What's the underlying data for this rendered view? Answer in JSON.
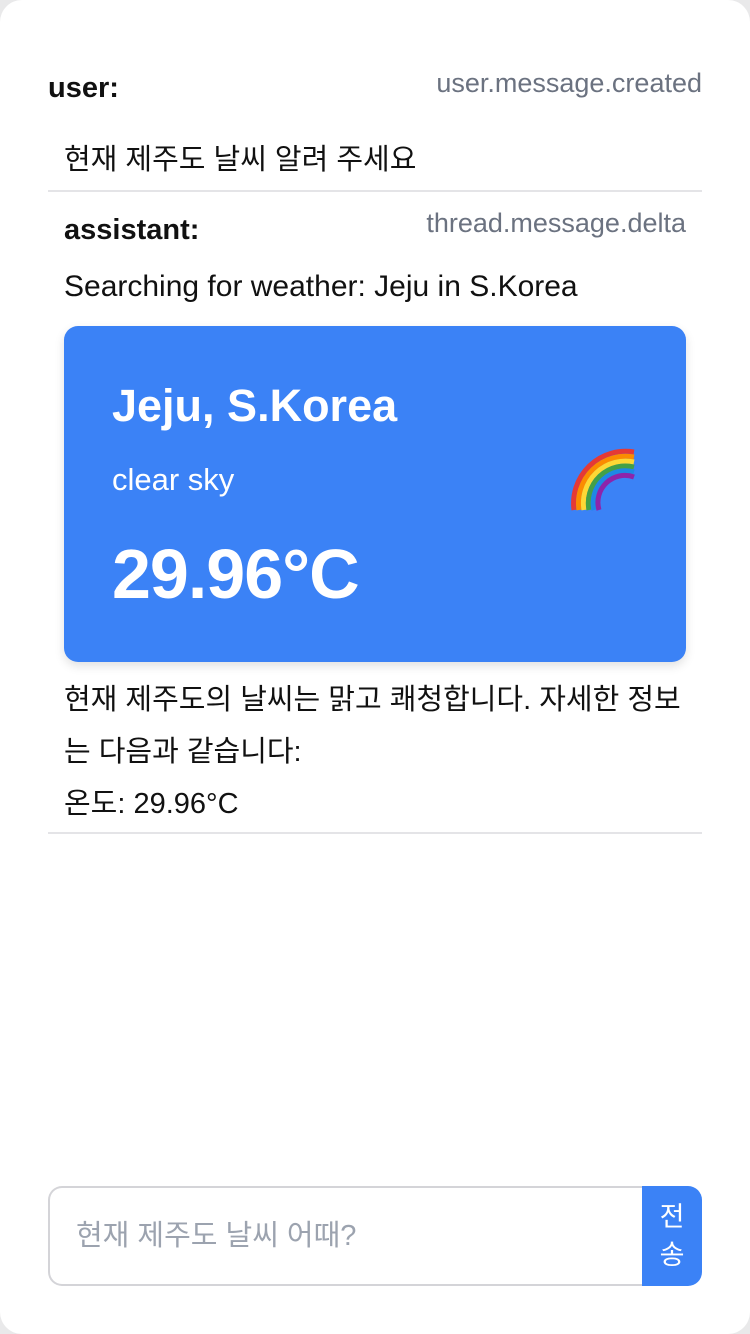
{
  "messages": [
    {
      "role": "user:",
      "event": "user.message.created",
      "text": "현재 제주도 날씨 알려 주세요"
    },
    {
      "role": "assistant:",
      "event": "thread.message.delta",
      "status": "Searching for weather: Jeju in S.Korea",
      "weather_card": {
        "city": "Jeju, S.Korea",
        "description": "clear sky",
        "temperature": "29.96°C",
        "icon": "rainbow-icon",
        "background_color": "#3b82f6"
      },
      "reply_line_1": "현재 제주도의 날씨는 맑고 쾌청합니다. 자세한 정보는 다음과 같습니다:",
      "reply_line_2": "온도: 29.96°C"
    }
  ],
  "composer": {
    "placeholder": "현재 제주도 날씨 어때?",
    "value": "",
    "send_label": "전송",
    "accent_color": "#3b82f6"
  }
}
